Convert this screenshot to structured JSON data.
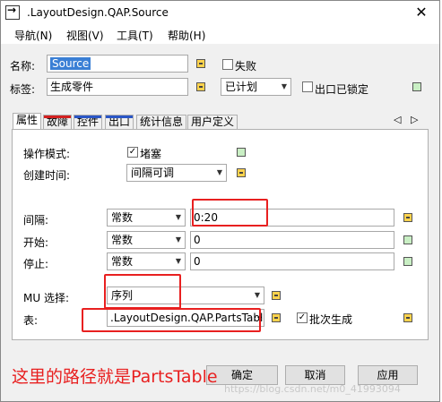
{
  "window": {
    "title": ".LayoutDesign.QAP.Source",
    "close": "✕"
  },
  "menu": [
    "导航(N)",
    "视图(V)",
    "工具(T)",
    "帮助(H)"
  ],
  "fields": {
    "name_label": "名称:",
    "name_value": "Source",
    "failed_label": "失败",
    "failed_checked": false,
    "tag_label": "标签:",
    "tag_value": "生成零件",
    "plan_value": "已计划",
    "exit_locked_label": "出口已锁定",
    "exit_locked_checked": false
  },
  "tabs": [
    {
      "label": "属性",
      "color": "#ffffff",
      "active": true
    },
    {
      "label": "故障",
      "color": "#d32020"
    },
    {
      "label": "控件",
      "color": "#2a56c6"
    },
    {
      "label": "出口",
      "color": "#2a56c6"
    },
    {
      "label": "统计信息",
      "color": "#f0f0f0"
    },
    {
      "label": "用户定义",
      "color": "#f0f0f0"
    }
  ],
  "tab_nav": {
    "prev": "◁",
    "next": "▷"
  },
  "properties": {
    "op_mode_label": "操作模式:",
    "blocking_label": "堵塞",
    "blocking_checked": true,
    "creation_time_label": "创建时间:",
    "creation_time_value": "间隔可调",
    "interval_label": "间隔:",
    "interval_mode": "常数",
    "interval_value": "0:20",
    "start_label": "开始:",
    "start_mode": "常数",
    "start_value": "0",
    "stop_label": "停止:",
    "stop_mode": "常数",
    "stop_value": "0",
    "mu_label": "MU 选择:",
    "mu_value": "序列",
    "table_label": "表:",
    "table_value": ".LayoutDesign.QAP.PartsTable",
    "table_more": "…",
    "batch_label": "批次生成",
    "batch_checked": true
  },
  "buttons": {
    "ok": "确定",
    "cancel": "取消",
    "apply": "应用"
  },
  "annotation": "这里的路径就是PartsTable",
  "watermark": "https://blog.csdn.net/m0_41993094",
  "colors": {
    "annotation_red": "#e82020",
    "selection_blue": "#3a7fd5"
  }
}
